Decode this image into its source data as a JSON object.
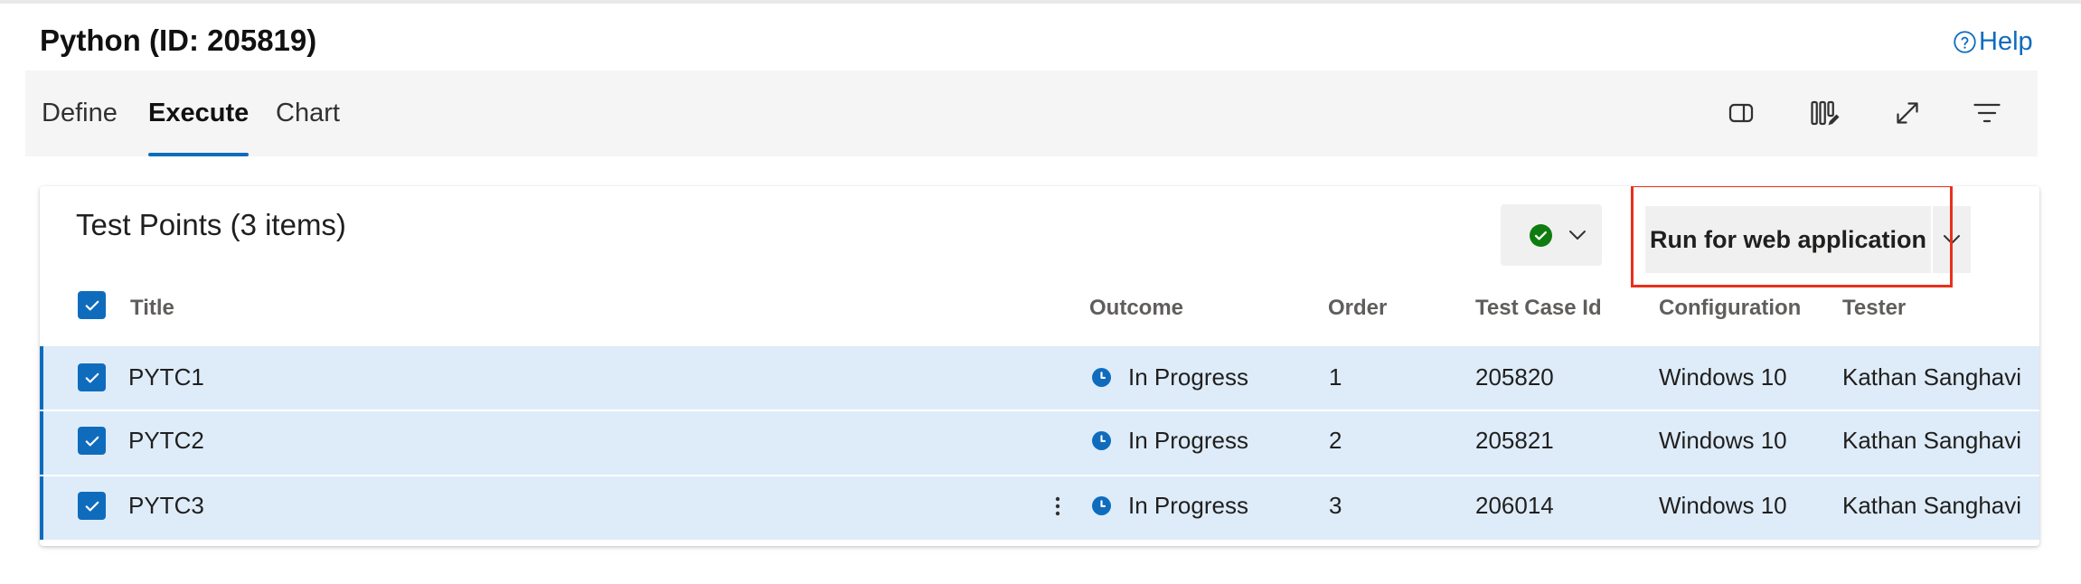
{
  "page": {
    "title": "Python (ID: 205819)",
    "help_label": "Help"
  },
  "tabs": [
    {
      "label": "Define",
      "selected": false
    },
    {
      "label": "Execute",
      "selected": true
    },
    {
      "label": "Chart",
      "selected": false
    }
  ],
  "toolbar_icons": [
    "side-panel-icon",
    "column-options-icon",
    "fullscreen-icon",
    "filter-icon"
  ],
  "test_points": {
    "title": "Test Points (3 items)",
    "outcome_button_icon": "check-circle-icon",
    "run_button_label": "Run for web application",
    "columns": {
      "title": "Title",
      "outcome": "Outcome",
      "order": "Order",
      "test_case_id": "Test Case Id",
      "configuration": "Configuration",
      "tester": "Tester"
    },
    "rows": [
      {
        "title": "PYTC1",
        "outcome": "In Progress",
        "order": "1",
        "test_case_id": "205820",
        "configuration": "Windows 10",
        "tester": "Kathan Sanghavi",
        "checked": true
      },
      {
        "title": "PYTC2",
        "outcome": "In Progress",
        "order": "2",
        "test_case_id": "205821",
        "configuration": "Windows 10",
        "tester": "Kathan Sanghavi",
        "checked": true
      },
      {
        "title": "PYTC3",
        "outcome": "In Progress",
        "order": "3",
        "test_case_id": "206014",
        "configuration": "Windows 10",
        "tester": "Kathan Sanghavi",
        "checked": true
      }
    ]
  },
  "colors": {
    "accent": "#0f6cbd",
    "row_selected": "#deecf9",
    "success": "#107c10",
    "highlight_box": "#e8301c"
  }
}
